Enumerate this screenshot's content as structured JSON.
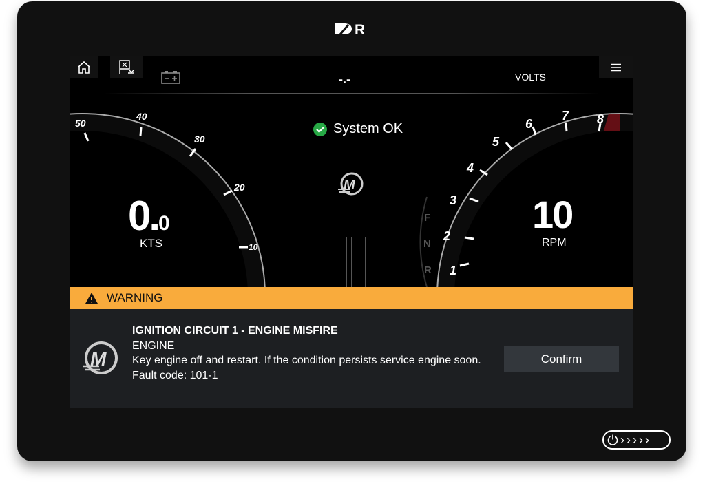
{
  "device": {
    "brand_logo": "R"
  },
  "topbar": {
    "home_icon": "home-icon",
    "nav_icon": "flag-icon",
    "battery_icon": "battery-icon",
    "battery_value": "-.-",
    "volts_label": "VOLTS",
    "menu_icon": "menu-icon"
  },
  "status": {
    "text": "System OK",
    "color": "#27a845"
  },
  "speed_gauge": {
    "value_int": "0.",
    "value_dec": "0",
    "unit": "KTS",
    "ticks": [
      "50",
      "40",
      "30",
      "20",
      "10"
    ]
  },
  "rpm_gauge": {
    "value": "10",
    "unit": "RPM",
    "ticks": [
      "1",
      "2",
      "3",
      "4",
      "5",
      "6",
      "7",
      "8"
    ],
    "redline_color": "#7a1018"
  },
  "gear": {
    "positions": [
      "F",
      "N",
      "R"
    ]
  },
  "warning": {
    "label": "WARNING",
    "color": "#f9ab3c",
    "title": "IGNITION CIRCUIT 1 - ENGINE MISFIRE",
    "source": "ENGINE",
    "message": "Key engine off and restart. If the condition persists service engine soon.",
    "fault_code": "Fault code: 101-1",
    "confirm_label": "Confirm"
  },
  "power_button": {
    "arrows": "›››››"
  }
}
